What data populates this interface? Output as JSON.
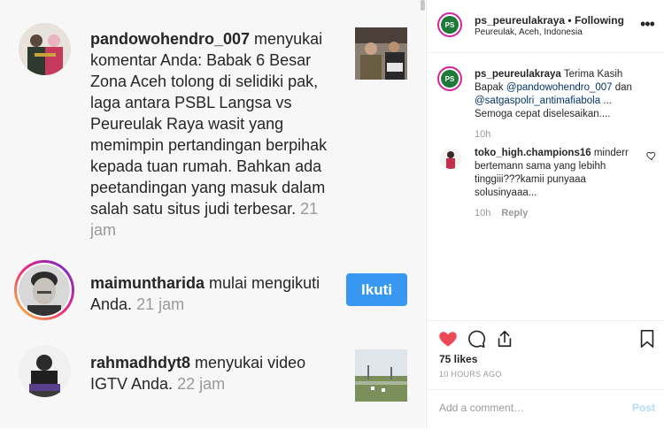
{
  "activity": [
    {
      "username": "pandowohendro_007",
      "message": "menyukai komentar Anda: Babak 6 Besar Zona Aceh tolong di selidiki pak, laga antara PSBL Langsa vs Peureulak Raya wasit yang memimpin pertandingan berpihak kepada tuan rumah. Bahkan ada peetandingan yang masuk dalam salah satu situs judi terbesar.",
      "time": "21 jam"
    },
    {
      "username": "maimuntharida",
      "message": "mulai mengikuti Anda.",
      "time": "21 jam",
      "button": "Ikuti"
    },
    {
      "username": "rahmadhdyt8",
      "message": "menyukai video IGTV Anda.",
      "time": "22 jam"
    }
  ],
  "post": {
    "header": {
      "username": "ps_peureulakraya",
      "separator": " • ",
      "follow_status": "Following",
      "location": "Peureulak, Aceh, Indonesia"
    },
    "caption": {
      "username": "ps_peureulakraya",
      "text_before": "Terima Kasih Bapak",
      "mention1": "@pandowohendro_007",
      "text_mid": "dan",
      "mention2": "@satgaspolri_antimafiabola",
      "text_after": "... Semoga cepat diselesaikan....",
      "time": "10h"
    },
    "comment": {
      "username": "toko_high.champions16",
      "text": "minderr bertemann sama yang lebihh tinggiii???kamii punyaaa solusinyaaa...",
      "time": "10h",
      "reply": "Reply"
    },
    "likes": "75 likes",
    "posted_ago": "10 HOURS AGO",
    "add_comment_placeholder": "Add a comment…",
    "post_label": "Post"
  },
  "colors": {
    "accent": "#3897f0",
    "like_red": "#ed4956",
    "mention": "#003569",
    "muted": "#999999"
  }
}
